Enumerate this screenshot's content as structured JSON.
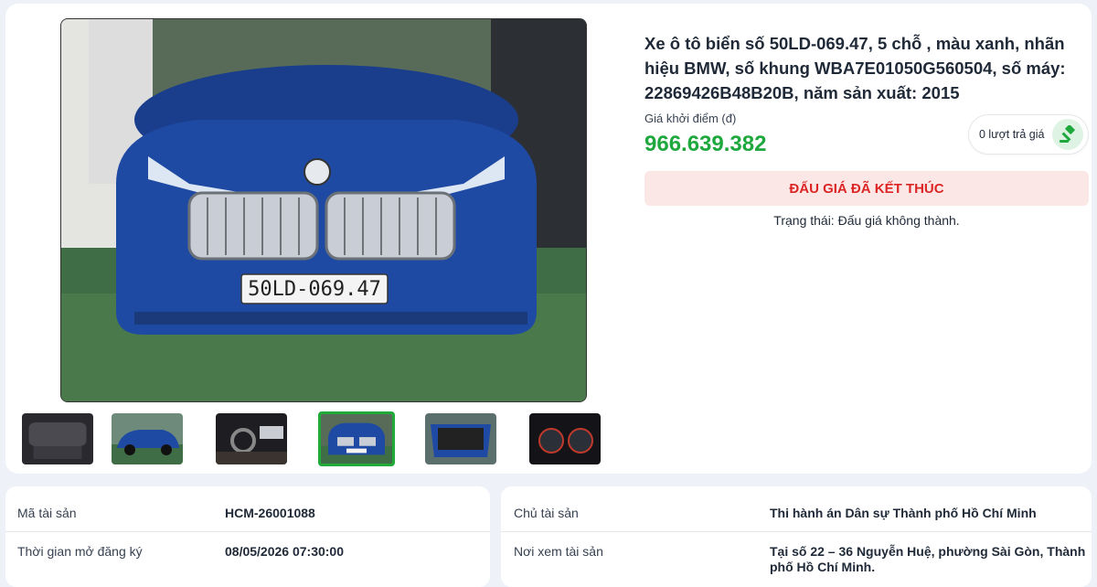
{
  "listing": {
    "title": "Xe ô tô biển số 50LD-069.47, 5 chỗ , màu xanh, nhãn hiệu BMW, số khung WBA7E01050G560504, số máy: 22869426B48B20B, năm sản xuất: 2015",
    "price_label": "Giá khởi điểm (đ)",
    "price": "966.639.382",
    "bid_count": "0 lượt trả giá",
    "status_button": "ĐẤU GIÁ ĐÃ KẾT THÚC",
    "status_text": "Trạng thái: Đấu giá không thành."
  },
  "photo": {
    "plate_text": "50LD-069.47",
    "thumbnails": [
      {
        "icon": "car-seat-interior-photo"
      },
      {
        "icon": "car-side-photo"
      },
      {
        "icon": "car-cockpit-photo"
      },
      {
        "icon": "car-front-photo",
        "active": true
      },
      {
        "icon": "car-trunk-photo"
      },
      {
        "icon": "car-dashboard-gauges-photo"
      }
    ]
  },
  "details_left": {
    "asset_code_label": "Mã tài sản",
    "asset_code_value": "HCM-26001088",
    "reg_time_label": "Thời gian mở đăng ký",
    "reg_time_value": "08/05/2026 07:30:00"
  },
  "details_right": {
    "owner_label": "Chủ tài sản",
    "owner_value": "Thi hành án Dân sự Thành phố Hồ Chí Minh",
    "view_place_label": "Nơi xem tài sản",
    "view_place_value_line1": "Tại số 22 – 36 Nguyễn Huệ, phường Sài Gòn, Thành",
    "view_place_value_line2": "phố Hồ Chí Minh."
  },
  "colors": {
    "price_green": "#1fa83d",
    "status_red": "#dc2626",
    "status_bg": "#fbe7e6",
    "active_thumb_border": "#1faa3a"
  }
}
